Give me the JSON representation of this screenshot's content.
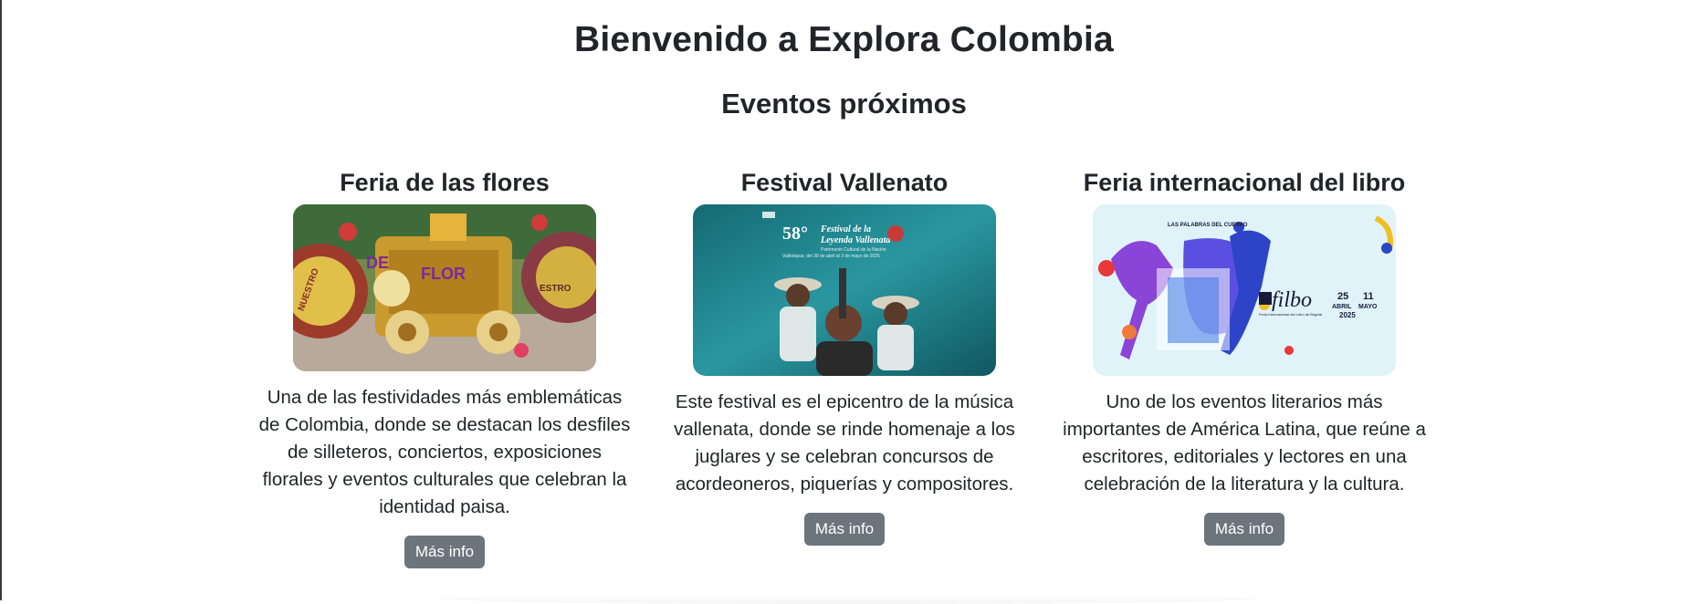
{
  "page": {
    "title": "Bienvenido a Explora Colombia",
    "section_title": "Eventos próximos"
  },
  "events": [
    {
      "title": "Feria de las flores",
      "description": "Una de las festividades más emblemáticas de Colombia, donde se destacan los desfiles de silleteros, conciertos, exposiciones florales y eventos culturales que celebran la identidad paisa.",
      "button": "Más info",
      "image_text": [
        "DE",
        "FLOR",
        "NUESTRO",
        "ESTRO"
      ]
    },
    {
      "title": "Festival Vallenato",
      "description": "Este festival es el epicentro de la música vallenata, donde se rinde homenaje a los juglares y se celebran concursos de acordeoneros, piquerías y compositores.",
      "button": "Más info",
      "image_text": [
        "58°",
        "Festival de la",
        "Leyenda Vallenata",
        "Patrimonio Cultural de la Nación",
        "Valledupar, del 30 de abril al 3 de mayo de 2025"
      ]
    },
    {
      "title": "Feria internacional del libro",
      "description": "Uno de los eventos literarios más importantes de América Latina, que reúne a escritores, editoriales y lectores en una celebración de la literatura y la cultura.",
      "button": "Más info",
      "image_text": [
        "LAS PALABRAS DEL CUERPO",
        "filbo",
        "Feria Internacional del Libro de Bogotá",
        "25",
        "11",
        "ABRIL",
        "MAYO",
        "2025"
      ]
    }
  ],
  "colors": {
    "text": "#212529",
    "button_bg": "#6c757d",
    "button_text": "#ffffff",
    "vallenato_teal": "#1f7f88",
    "filbo_blue": "#3a4fd0",
    "filbo_bg": "#dff3f9"
  }
}
